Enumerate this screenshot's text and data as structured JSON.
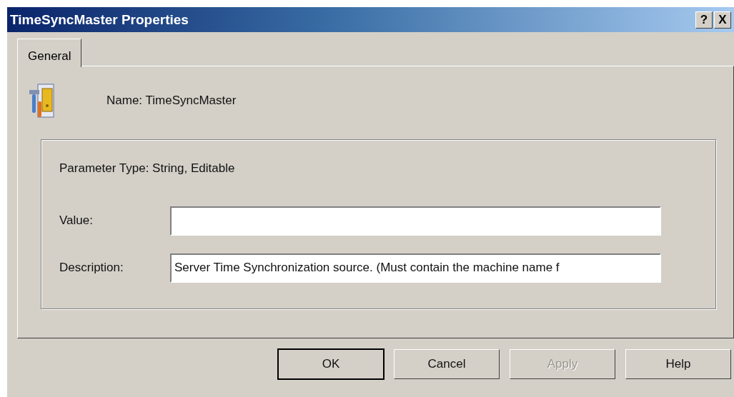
{
  "window": {
    "title": "TimeSyncMaster Properties",
    "title_buttons": [
      "?",
      "X"
    ]
  },
  "tabs": [
    {
      "label": "General",
      "selected": true
    }
  ],
  "name_line": "Name: TimeSyncMaster",
  "parameter_type": "Parameter Type: String, Editable",
  "fields": [
    {
      "label": "Value:"
    },
    {
      "label": "Description:",
      "value": "Server Time Synchronization source. (Must contain the machine name f"
    }
  ],
  "buttons": [
    {
      "label": "OK",
      "default": true,
      "disabled": false
    },
    {
      "label": "Cancel",
      "default": false,
      "disabled": false
    },
    {
      "label": "Apply",
      "default": false,
      "disabled": true
    },
    {
      "label": "Help",
      "default": false,
      "disabled": false
    }
  ]
}
